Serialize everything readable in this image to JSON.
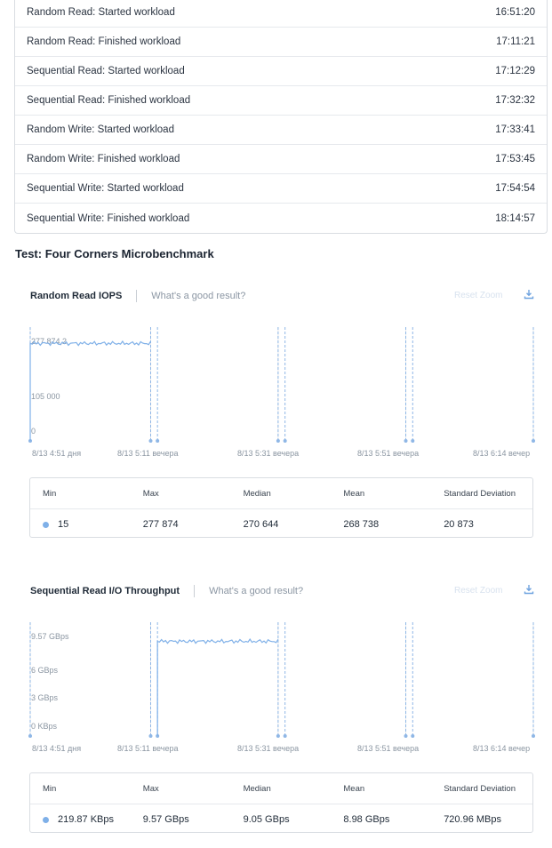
{
  "log": [
    {
      "event": "Random Read: Started workload",
      "time": "16:51:20"
    },
    {
      "event": "Random Read: Finished workload",
      "time": "17:11:21"
    },
    {
      "event": "Sequential Read: Started workload",
      "time": "17:12:29"
    },
    {
      "event": "Sequential Read: Finished workload",
      "time": "17:32:32"
    },
    {
      "event": "Random Write: Started workload",
      "time": "17:33:41"
    },
    {
      "event": "Random Write: Finished workload",
      "time": "17:53:45"
    },
    {
      "event": "Sequential Write: Started workload",
      "time": "17:54:54"
    },
    {
      "event": "Sequential Write: Finished workload",
      "time": "18:14:57"
    }
  ],
  "section_title": "Test: Four Corners Microbenchmark",
  "charts": [
    {
      "title": "Random Read IOPS",
      "good_result": "What's a good result?",
      "reset_zoom": "Reset Zoom",
      "stats_headers": [
        "Min",
        "Max",
        "Median",
        "Mean",
        "Standard Deviation"
      ],
      "stats_values": [
        "15",
        "277 874",
        "270 644",
        "268 738",
        "20 873"
      ]
    },
    {
      "title": "Sequential Read I/O Throughput",
      "good_result": "What's a good result?",
      "reset_zoom": "Reset Zoom",
      "stats_headers": [
        "Min",
        "Max",
        "Median",
        "Mean",
        "Standard Deviation"
      ],
      "stats_values": [
        "219.87 KBps",
        "9.57 GBps",
        "9.05 GBps",
        "8.98 GBps",
        "720.96 MBps"
      ]
    }
  ],
  "chart_data": [
    {
      "type": "line",
      "title": "Random Read IOPS",
      "x_ticks": [
        "8/13 4:51 дня",
        "8/13 5:11 вечера",
        "8/13 5:31 вечера",
        "8/13 5:51 вечера",
        "8/13 6:14 вечер"
      ],
      "y_ticks": [
        "277 874,2",
        "105 000",
        "0"
      ],
      "ylim": [
        0,
        277874.2
      ],
      "series_color": "#7fb0e8",
      "event_markers": [
        "16:51:20",
        "17:11:21",
        "17:12:29",
        "17:32:32",
        "17:33:41",
        "17:53:45",
        "17:54:54",
        "18:14:57"
      ],
      "series": [
        {
          "x_start": "16:51:20",
          "x_end": "17:11:21",
          "level": 270644,
          "start_value": 15
        }
      ]
    },
    {
      "type": "line",
      "title": "Sequential Read I/O Throughput",
      "x_ticks": [
        "8/13 4:51 дня",
        "8/13 5:11 вечера",
        "8/13 5:31 вечера",
        "8/13 5:51 вечера",
        "8/13 6:14 вечер"
      ],
      "y_ticks": [
        "9.57 GBps",
        "6 GBps",
        "3 GBps",
        "0 KBps"
      ],
      "ylim_gbps": [
        0,
        9.57
      ],
      "series_color": "#7fb0e8",
      "event_markers": [
        "16:51:20",
        "17:11:21",
        "17:12:29",
        "17:32:32",
        "17:33:41",
        "17:53:45",
        "17:54:54",
        "18:14:57"
      ],
      "series": [
        {
          "x_start": "17:12:29",
          "x_end": "17:32:32",
          "level_gbps": 9.05,
          "start_value_gbps": 0.0002
        }
      ]
    }
  ]
}
